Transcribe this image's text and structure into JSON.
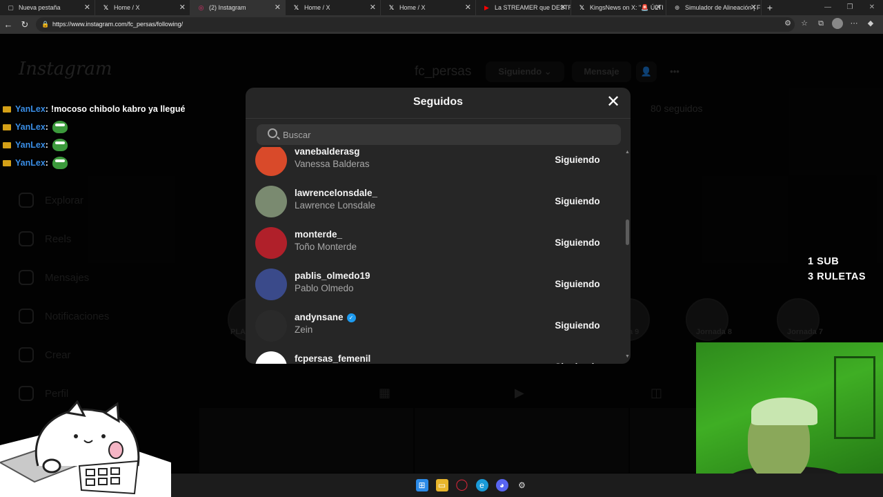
{
  "browser": {
    "tabs": [
      {
        "title": "Nueva pestaña",
        "icon": "new-tab-icon"
      },
      {
        "title": "Home / X",
        "icon": "x-icon"
      },
      {
        "title": "(2) Instagram",
        "icon": "instagram-icon"
      },
      {
        "title": "Home / X",
        "icon": "x-icon"
      },
      {
        "title": "Home / X",
        "icon": "x-icon"
      },
      {
        "title": "La STREAMER que DESTRU",
        "icon": "youtube-icon"
      },
      {
        "title": "KingsNews on X: \"🚨 ÚLTI",
        "icon": "x-icon"
      },
      {
        "title": "Simulador de Alineación | F",
        "icon": "globe-icon"
      }
    ],
    "active_tab": 2,
    "url": "https://www.instagram.com/fc_persas/following/"
  },
  "instagram": {
    "logo": "Instagram",
    "sidebar": [
      "Explorar",
      "Reels",
      "Mensajes",
      "Notificaciones",
      "Crear",
      "Perfil"
    ],
    "profile": {
      "username": "fc_persas",
      "following_button": "Siguiendo",
      "message_button": "Mensaje",
      "following_count": "80 seguidos"
    },
    "highlights": [
      {
        "label": "PLA"
      },
      {
        "label": "a 9"
      },
      {
        "label": "Jornada 8"
      },
      {
        "label": "Jornada 7"
      }
    ]
  },
  "modal": {
    "title": "Seguidos",
    "search_placeholder": "Buscar",
    "follow_label": "Siguiendo",
    "users": [
      {
        "username": "vanebalderasg",
        "name": "Vanessa Balderas",
        "verified": false,
        "avatar_color": "#d94a2a"
      },
      {
        "username": "lawrencelonsdale_",
        "name": "Lawrence Lonsdale",
        "verified": false,
        "avatar_color": "#7a8a70"
      },
      {
        "username": "monterde_",
        "name": "Toño Monterde",
        "verified": false,
        "avatar_color": "#b0202a"
      },
      {
        "username": "pablis_olmedo19",
        "name": "Pablo Olmedo",
        "verified": false,
        "avatar_color": "#3a4a8a"
      },
      {
        "username": "andynsane",
        "name": "Zein",
        "verified": true,
        "avatar_color": "#2a2a2a"
      },
      {
        "username": "fcpersas_femenil",
        "name": "",
        "verified": false,
        "avatar_color": "#ffffff"
      }
    ]
  },
  "stream": {
    "chat": [
      {
        "user": "YanLex",
        "message": "!mocoso chibolo kabro ya llegué",
        "emote": false
      },
      {
        "user": "YanLex",
        "message": "",
        "emote": true
      },
      {
        "user": "YanLex",
        "message": "",
        "emote": true
      },
      {
        "user": "YanLex",
        "message": "",
        "emote": true
      }
    ],
    "promo_line1": "1 SUB",
    "promo_line2": "3 RULETAS"
  }
}
